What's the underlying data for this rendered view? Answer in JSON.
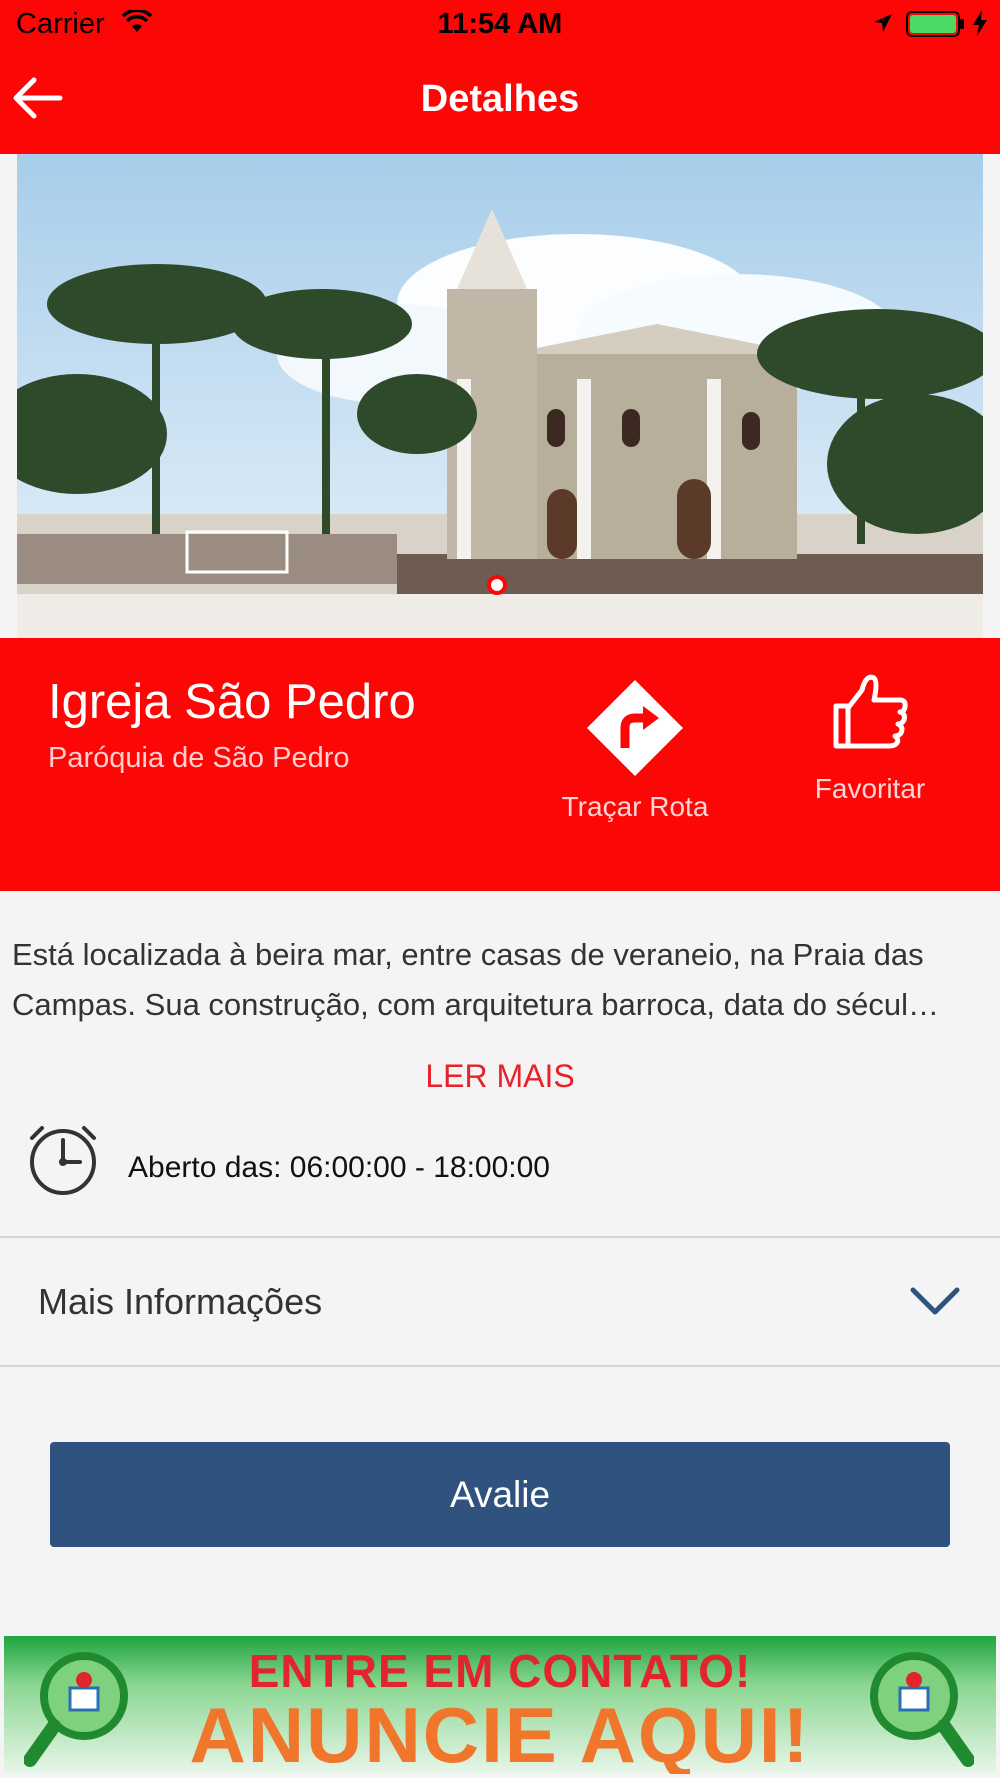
{
  "status_bar": {
    "carrier": "Carrier",
    "time": "11:54 AM"
  },
  "nav": {
    "title": "Detalhes"
  },
  "place": {
    "name": "Igreja São Pedro",
    "subtitle": "Paróquia de São Pedro",
    "route_label": "Traçar Rota",
    "favorite_label": "Favoritar"
  },
  "description": "Está localizada à beira mar, entre casas de veraneio, na Praia das Campas. Sua construção, com arquitetura barroca, data do sécul…",
  "read_more_label": "LER MAIS",
  "hours": "Aberto das: 06:00:00 - 18:00:00",
  "more_info_label": "Mais Informações",
  "rate_button_label": "Avalie",
  "ad": {
    "line1": "ENTRE EM CONTATO!",
    "line2": "ANUNCIE AQUI!"
  },
  "colors": {
    "primary_red": "#fd0606",
    "button_blue": "#2f527e",
    "link_red": "#e8222b"
  }
}
